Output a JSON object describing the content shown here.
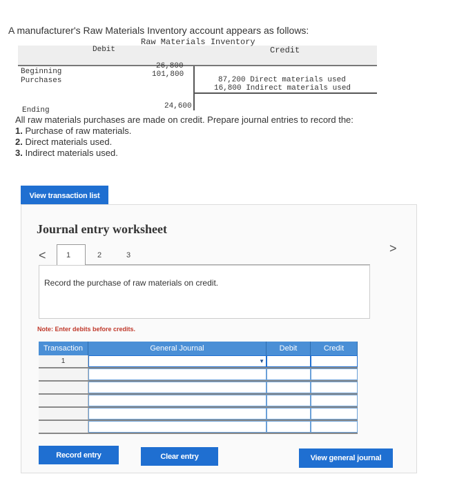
{
  "problem": {
    "intro": "A manufacturer's Raw Materials Inventory account appears as follows:",
    "account": {
      "title": "Raw Materials Inventory",
      "debit_header": "Debit",
      "credit_header": "Credit",
      "beginning_label": "Beginning",
      "beginning_amount": "26,800",
      "purchases_label": "Purchases",
      "purchases_amount": "101,800",
      "credit_line1": "87,200 Direct materials used",
      "credit_line2": "16,800 Indirect materials used",
      "ending_label": "Ending",
      "ending_amount": "24,600"
    },
    "instruction": "All raw materials purchases are made on credit. Prepare journal entries to record the:",
    "items": [
      {
        "num": "1.",
        "text": "Purchase of raw materials."
      },
      {
        "num": "2.",
        "text": "Direct materials used."
      },
      {
        "num": "3.",
        "text": "Indirect materials used."
      }
    ]
  },
  "view_transaction_label": "View transaction list",
  "worksheet": {
    "title": "Journal entry worksheet",
    "prev_glyph": "<",
    "next_glyph": ">",
    "tabs": [
      "1",
      "2",
      "3"
    ],
    "prompt": "Record the purchase of raw materials on credit.",
    "note": "Note: Enter debits before credits.",
    "columns": [
      "Transaction",
      "General Journal",
      "Debit",
      "Credit"
    ],
    "first_row_transaction": "1",
    "dropdown_glyph": "▼"
  },
  "buttons": {
    "record": "Record entry",
    "clear": "Clear entry",
    "view_general": "View general journal"
  },
  "colors": {
    "accent": "#1f6fd1",
    "header_blue": "#4a8fd6",
    "note_red": "#c0392b"
  }
}
